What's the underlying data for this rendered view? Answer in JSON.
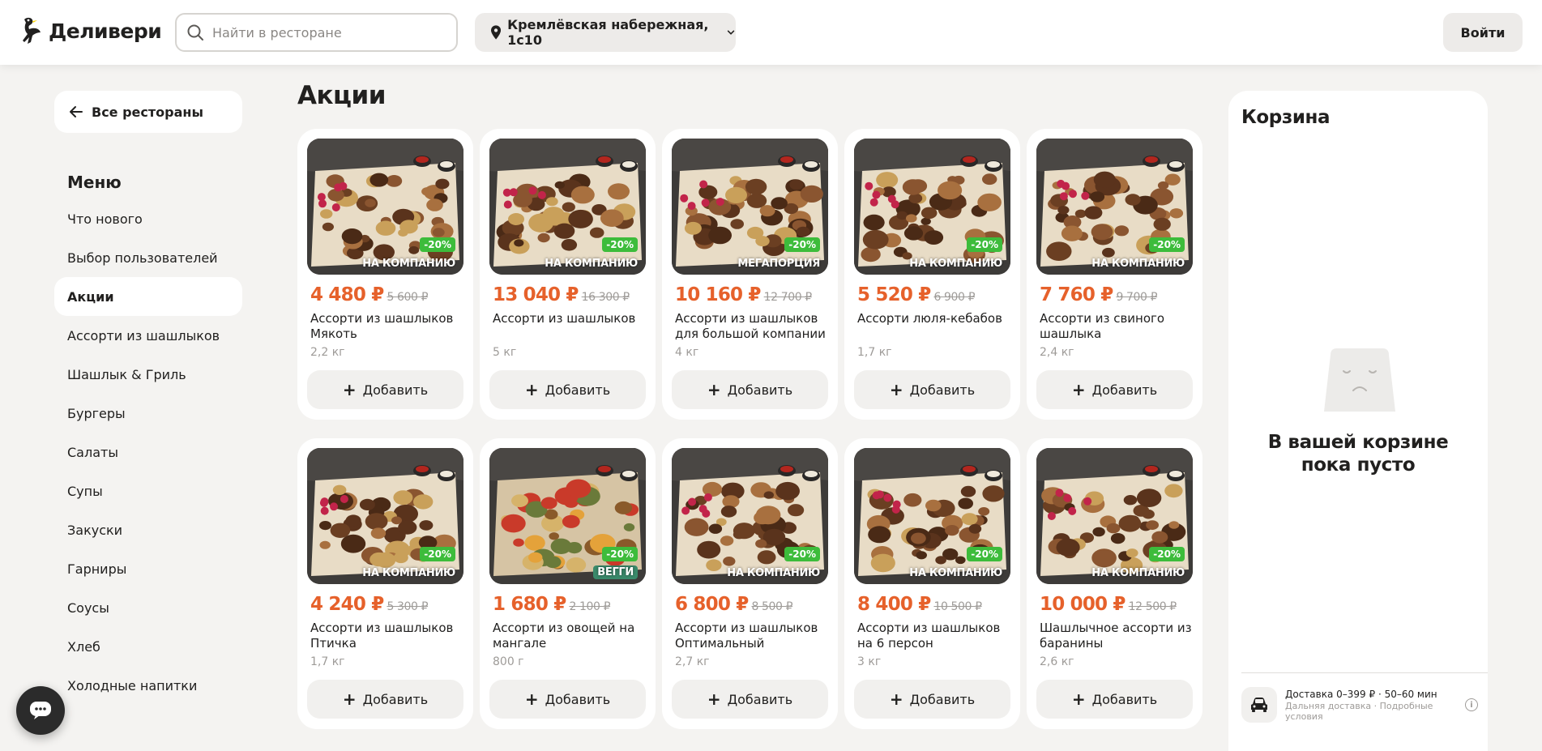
{
  "header": {
    "logo_text": "Деливери",
    "search_placeholder": "Найти в ресторане",
    "address": "Кремлёвская набережная, 1с10",
    "login_label": "Войти"
  },
  "sidebar": {
    "back_label": "Все рестораны",
    "menu_title": "Меню",
    "items": [
      {
        "label": "Что нового"
      },
      {
        "label": "Выбор пользователей"
      },
      {
        "label": "Акции"
      },
      {
        "label": "Ассорти из шашлыков"
      },
      {
        "label": "Шашлык & Гриль"
      },
      {
        "label": "Бургеры"
      },
      {
        "label": "Салаты"
      },
      {
        "label": "Супы"
      },
      {
        "label": "Закуски"
      },
      {
        "label": "Гарниры"
      },
      {
        "label": "Соусы"
      },
      {
        "label": "Хлеб"
      },
      {
        "label": "Холодные напитки"
      }
    ],
    "active_index": 2
  },
  "main": {
    "title": "Акции",
    "add_label": "Добавить",
    "products": [
      {
        "price": "4 480 ₽",
        "old_price": "5 600 ₽",
        "name": "Ассорти из шашлыков Мякоть",
        "weight": "2,2 кг",
        "discount": "-20%",
        "tag": "НА КОМПАНИЮ"
      },
      {
        "price": "13 040 ₽",
        "old_price": "16 300 ₽",
        "name": "Ассорти из шашлыков",
        "weight": "5 кг",
        "discount": "-20%",
        "tag": "НА КОМПАНИЮ"
      },
      {
        "price": "10 160 ₽",
        "old_price": "12 700 ₽",
        "name": "Ассорти из шашлыков для большой компании",
        "weight": "4 кг",
        "discount": "-20%",
        "tag": "МЕГАПОРЦИЯ"
      },
      {
        "price": "5 520 ₽",
        "old_price": "6 900 ₽",
        "name": "Ассорти люля-кебабов",
        "weight": "1,7 кг",
        "discount": "-20%",
        "tag": "НА КОМПАНИЮ"
      },
      {
        "price": "7 760 ₽",
        "old_price": "9 700 ₽",
        "name": "Ассорти из свиного шашлыка",
        "weight": "2,4 кг",
        "discount": "-20%",
        "tag": "НА КОМПАНИЮ"
      },
      {
        "price": "4 240 ₽",
        "old_price": "5 300 ₽",
        "name": "Ассорти из шашлыков Птичка",
        "weight": "1,7 кг",
        "discount": "-20%",
        "tag": "НА КОМПАНИЮ"
      },
      {
        "price": "1 680 ₽",
        "old_price": "2 100 ₽",
        "name": "Ассорти из овощей на мангале",
        "weight": "800 г",
        "discount": "-20%",
        "tag": "ВЕГГИ"
      },
      {
        "price": "6 800 ₽",
        "old_price": "8 500 ₽",
        "name": "Ассорти из шашлыков Оптимальный",
        "weight": "2,7 кг",
        "discount": "-20%",
        "tag": "НА КОМПАНИЮ"
      },
      {
        "price": "8 400 ₽",
        "old_price": "10 500 ₽",
        "name": "Ассорти из шашлыков на 6 персон",
        "weight": "3 кг",
        "discount": "-20%",
        "tag": "НА КОМПАНИЮ"
      },
      {
        "price": "10 000 ₽",
        "old_price": "12 500 ₽",
        "name": "Шашлычное ассорти из баранины",
        "weight": "2,6 кг",
        "discount": "-20%",
        "tag": "НА КОМПАНИЮ"
      }
    ]
  },
  "cart": {
    "title": "Корзина",
    "empty_line1": "В вашей корзине",
    "empty_line2": "пока пусто",
    "delivery_main": "Доставка 0–399 ₽ · 50–60 мин",
    "delivery_sub": "Дальняя доставка · Подробные условия"
  },
  "colors": {
    "accent_price": "#e6612b",
    "discount_badge": "#3dbc3b",
    "veg_badge": "#3a8a6b",
    "background": "#f4f3f1"
  },
  "icons": {
    "logo": "ostrich-logo",
    "search": "search-icon",
    "address": "location-pin-icon",
    "address_dropdown": "chevron-down-icon",
    "back": "arrow-left-icon",
    "add": "plus-icon",
    "chat": "chat-icon",
    "delivery": "car-icon",
    "info": "info-icon",
    "empty_cart": "empty-bag-icon"
  }
}
